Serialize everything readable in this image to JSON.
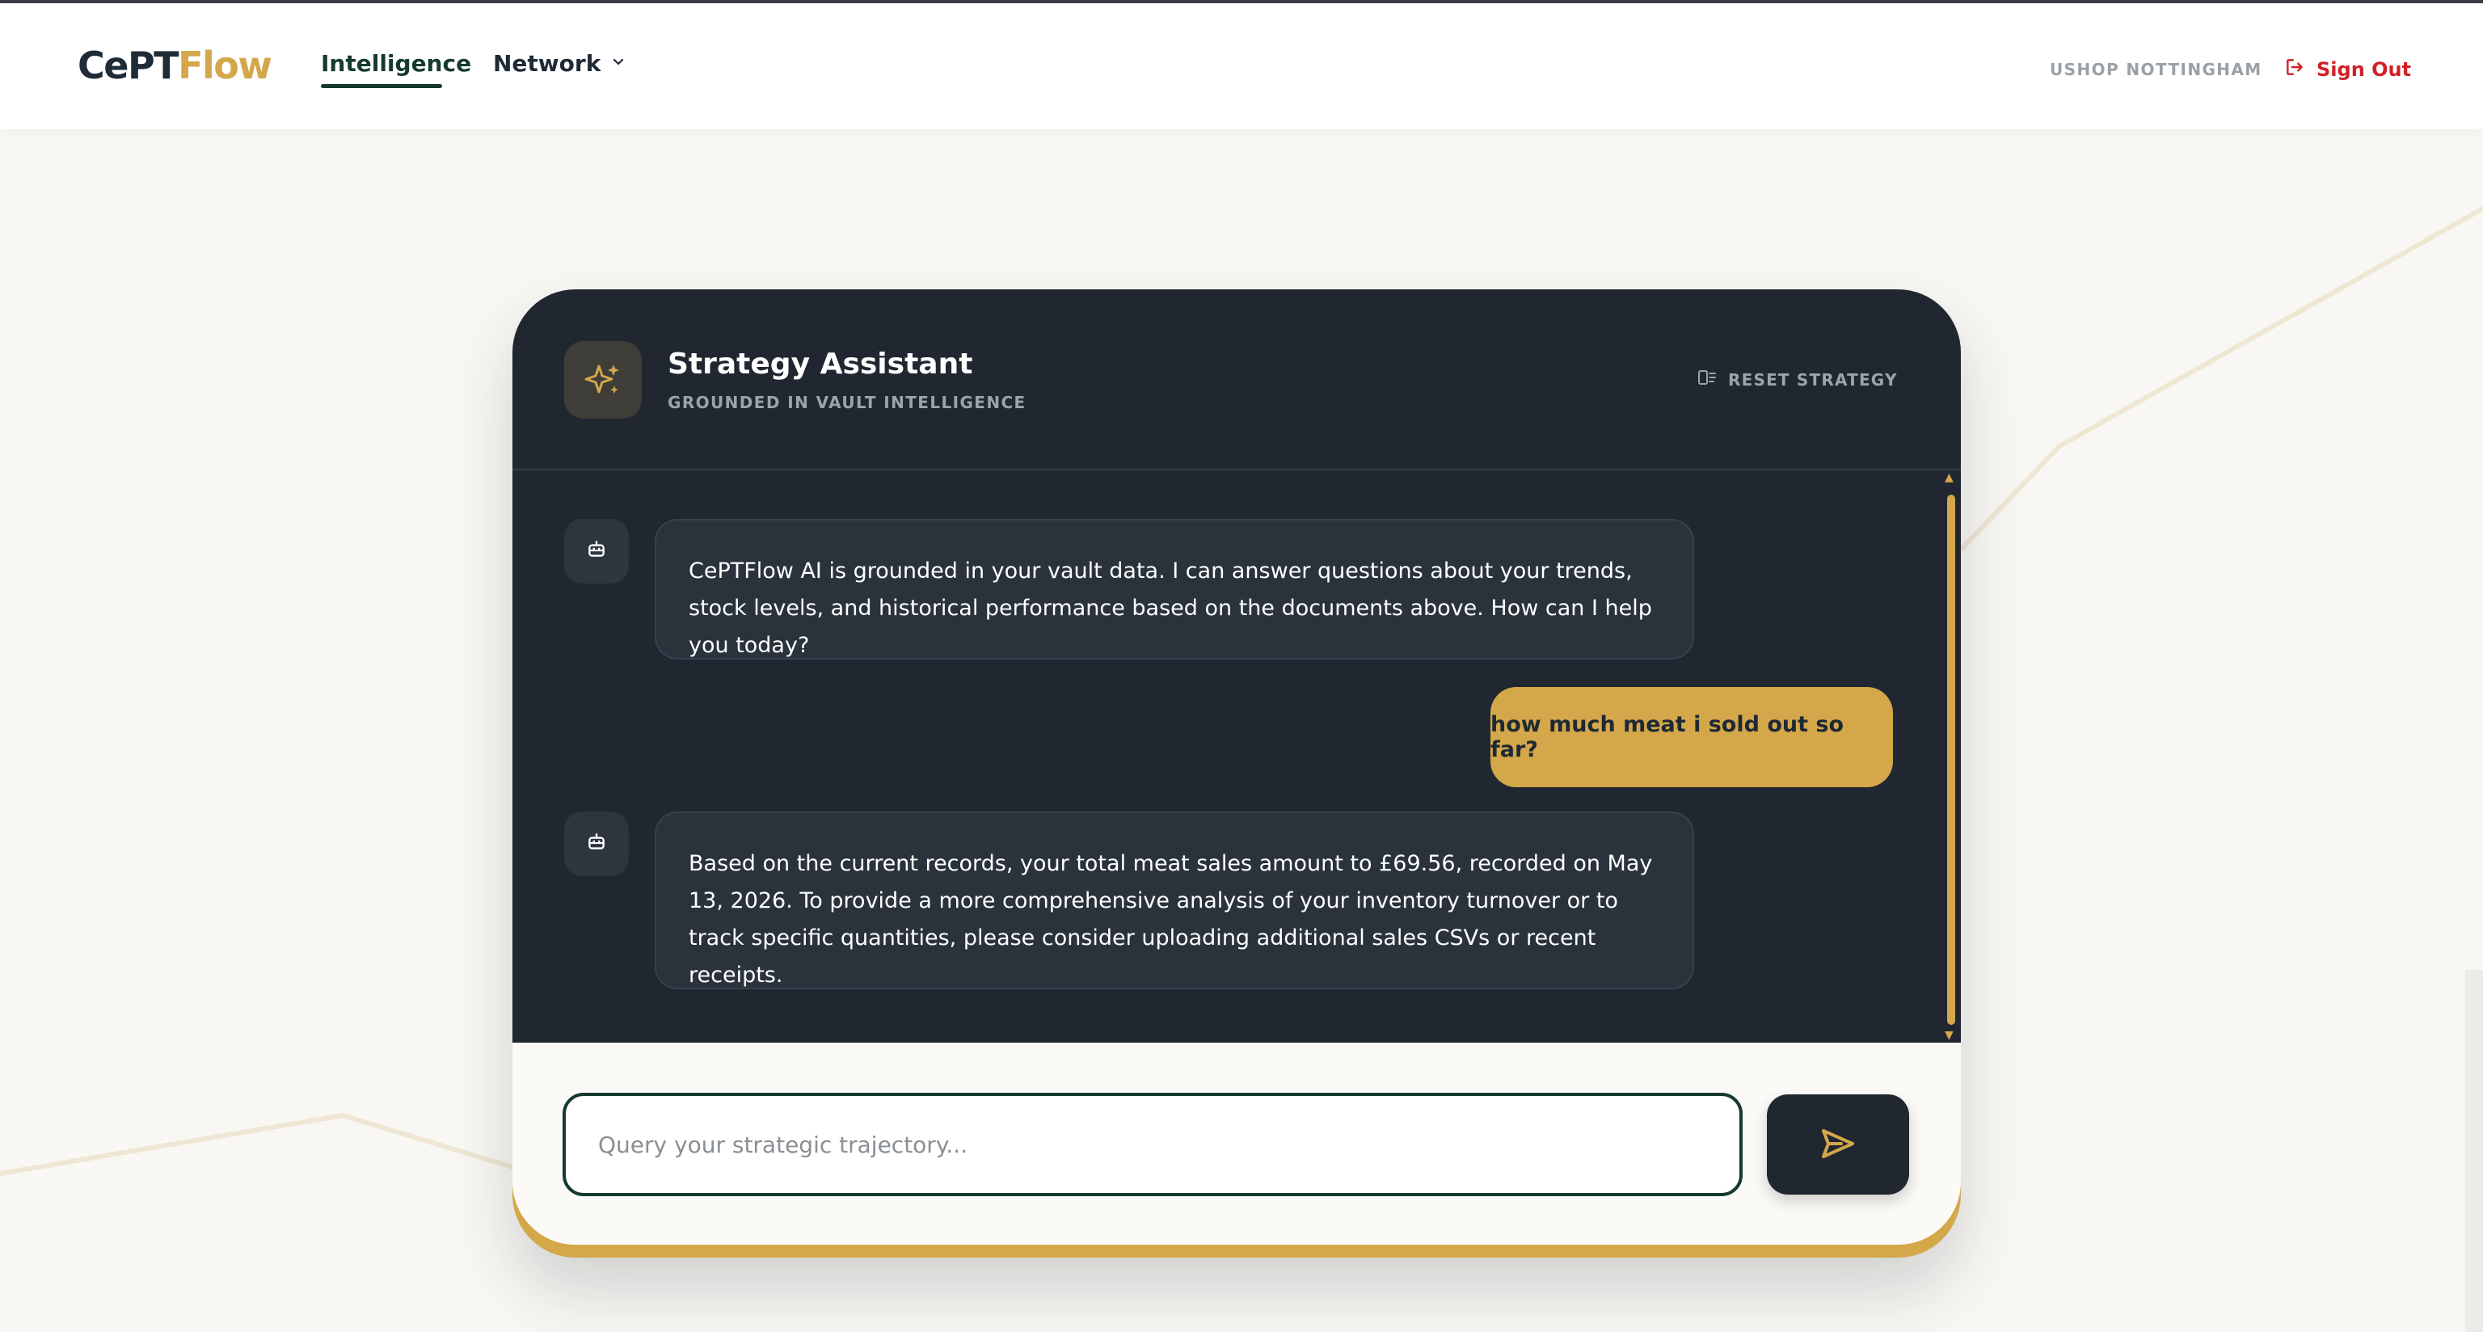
{
  "app": {
    "logo_part1": "CePT",
    "logo_part2": "Flow"
  },
  "nav": {
    "items": [
      {
        "label": "Intelligence",
        "active": true
      },
      {
        "label": "Network",
        "has_dropdown": true
      }
    ],
    "store_name": "USHOP NOTTINGHAM",
    "sign_out_label": "Sign Out"
  },
  "assistant": {
    "title": "Strategy Assistant",
    "subtitle": "GROUNDED IN VAULT INTELLIGENCE",
    "reset_label": "RESET STRATEGY",
    "icon": "sparkles-icon"
  },
  "messages": [
    {
      "role": "assistant",
      "text": "CePTFlow AI is grounded in your vault data. I can answer questions about your trends, stock levels, and historical performance based on the documents above. How can I help you today?"
    },
    {
      "role": "user",
      "text": "how much meat i sold out so far?"
    },
    {
      "role": "assistant",
      "text": "Based on the current records, your total meat sales amount to £69.56, recorded on May 13, 2026. To provide a more comprehensive analysis of your inventory turnover or to track specific quantities, please consider uploading additional sales CSVs or recent receipts."
    }
  ],
  "composer": {
    "placeholder": "Query your strategic trajectory...",
    "value": "",
    "send_icon": "send-icon"
  },
  "colors": {
    "accent_gold": "#d4a74a",
    "dark_panel": "#202731",
    "brand_green": "#163a2f",
    "danger_red": "#d21f26"
  }
}
